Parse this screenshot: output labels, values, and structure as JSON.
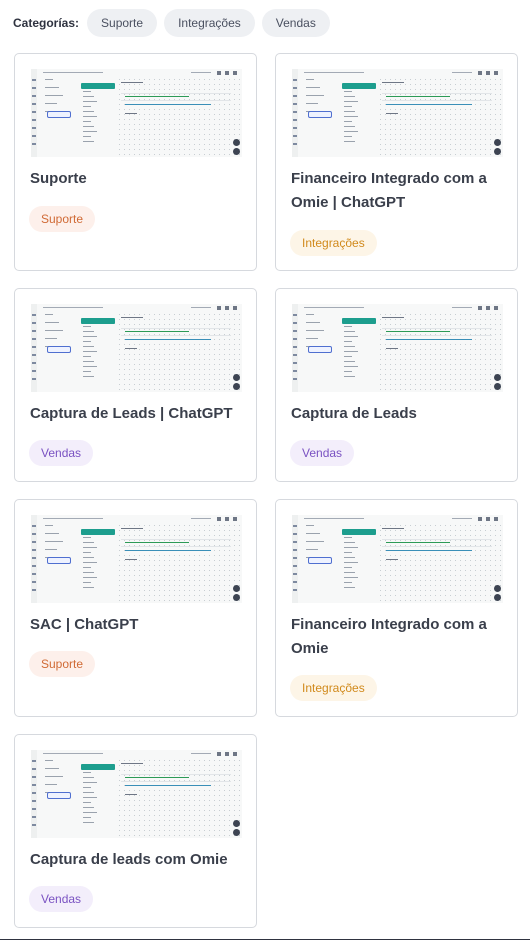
{
  "filters": {
    "label": "Categorías:",
    "chips": [
      "Suporte",
      "Integrações",
      "Vendas"
    ]
  },
  "cards": [
    {
      "title": "Suporte",
      "tag": "Suporte",
      "tag_type": "suporte"
    },
    {
      "title": "Financeiro Integrado com a Omie | ChatGPT",
      "tag": "Integrações",
      "tag_type": "integracoes"
    },
    {
      "title": "Captura de Leads | ChatGPT",
      "tag": "Vendas",
      "tag_type": "vendas"
    },
    {
      "title": "Captura de Leads",
      "tag": "Vendas",
      "tag_type": "vendas"
    },
    {
      "title": "SAC | ChatGPT",
      "tag": "Suporte",
      "tag_type": "suporte"
    },
    {
      "title": "Financeiro Integrado com a Omie",
      "tag": "Integrações",
      "tag_type": "integracoes"
    },
    {
      "title": "Captura de leads com Omie",
      "tag": "Vendas",
      "tag_type": "vendas"
    }
  ],
  "colors": {
    "suporte": "#d06a35",
    "integracoes": "#d18a1c",
    "vendas": "#7a52c2",
    "accent_teal": "#1d9e8e"
  }
}
